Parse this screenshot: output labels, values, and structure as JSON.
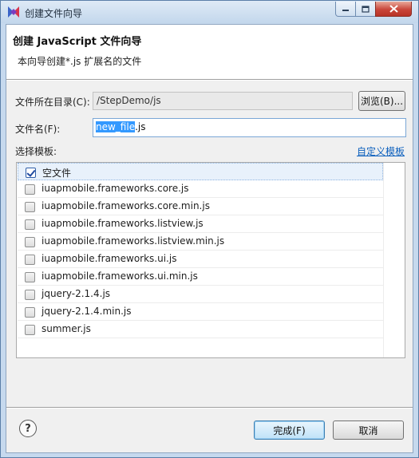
{
  "window": {
    "title": "创建文件向导",
    "icons": {
      "app": "wizard-app-icon",
      "minimize": "minimize-icon",
      "maximize": "maximize-icon",
      "close": "close-icon"
    },
    "colors": {
      "accent": "#3399ff",
      "link": "#0b5fbd"
    }
  },
  "header": {
    "title": "创建 JavaScript 文件向导",
    "description": "本向导创建*.js 扩展名的文件"
  },
  "form": {
    "directory": {
      "label": "文件所在目录(C):",
      "value": "/StepDemo/js",
      "browse_label": "浏览(B)..."
    },
    "filename": {
      "label": "文件名(F):",
      "selected_text": "new_file",
      "rest_text": ".js"
    },
    "template": {
      "label": "选择模板:",
      "custom_link": "自定义模板",
      "items": [
        {
          "label": "空文件",
          "checked": true
        },
        {
          "label": "iuapmobile.frameworks.core.js",
          "checked": false
        },
        {
          "label": "iuapmobile.frameworks.core.min.js",
          "checked": false
        },
        {
          "label": "iuapmobile.frameworks.listview.js",
          "checked": false
        },
        {
          "label": "iuapmobile.frameworks.listview.min.js",
          "checked": false
        },
        {
          "label": "iuapmobile.frameworks.ui.js",
          "checked": false
        },
        {
          "label": "iuapmobile.frameworks.ui.min.js",
          "checked": false
        },
        {
          "label": "jquery-2.1.4.js",
          "checked": false
        },
        {
          "label": "jquery-2.1.4.min.js",
          "checked": false
        },
        {
          "label": "summer.js",
          "checked": false
        }
      ]
    }
  },
  "footer": {
    "help_icon": "help-icon",
    "help_glyph": "?",
    "finish_label": "完成(F)",
    "cancel_label": "取消"
  }
}
